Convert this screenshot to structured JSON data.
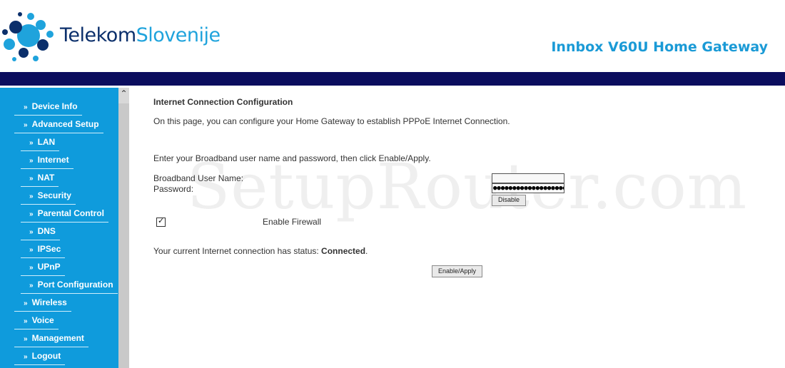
{
  "header": {
    "brand_part1": "Telekom",
    "brand_part2": "Slovenije",
    "product_title": "Innbox V60U Home Gateway"
  },
  "sidebar": {
    "items": [
      {
        "label": "Device Info",
        "indent": 0
      },
      {
        "label": "Advanced Setup",
        "indent": 0
      },
      {
        "label": "LAN",
        "indent": 1
      },
      {
        "label": "Internet",
        "indent": 1
      },
      {
        "label": "NAT",
        "indent": 1
      },
      {
        "label": "Security",
        "indent": 1
      },
      {
        "label": "Parental Control",
        "indent": 1
      },
      {
        "label": "DNS",
        "indent": 1
      },
      {
        "label": "IPSec",
        "indent": 1
      },
      {
        "label": "UPnP",
        "indent": 1
      },
      {
        "label": "Port Configuration",
        "indent": 1
      },
      {
        "label": "Wireless",
        "indent": 0
      },
      {
        "label": "Voice",
        "indent": 0
      },
      {
        "label": "Management",
        "indent": 0
      },
      {
        "label": "Logout",
        "indent": 0
      }
    ]
  },
  "main": {
    "title": "Internet Connection Configuration",
    "description": "On this page, you can configure your Home Gateway to establish PPPoE Internet Connection.",
    "instructions": "Enter your Broadband user name and password, then click Enable/Apply.",
    "username_label": "Broadband User Name:",
    "password_label": "Password:",
    "username_value": "",
    "password_value": "●●●●●●●●●●●●●●●●●●●",
    "disable_label": "Disable",
    "firewall_label": "Enable Firewall",
    "firewall_checked": "✓",
    "status_text": "Your current Internet connection has status: ",
    "status_value": "Connected",
    "status_period": ".",
    "apply_label": "Enable/Apply"
  },
  "watermark": "SetupRouter.com",
  "colors": {
    "accent": "#1a9ad6",
    "sidebar": "#0f9bdc",
    "band": "#0b0d5e",
    "brand_dark": "#0b2f6b"
  }
}
